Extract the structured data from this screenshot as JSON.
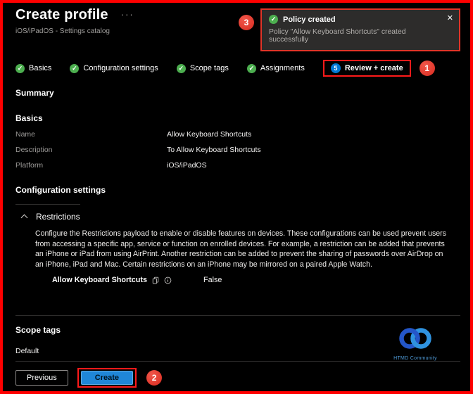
{
  "colors": {
    "accent_blue": "#0078d4",
    "success_green": "#4cae4f",
    "annotation_red": "#e23527",
    "highlight_red": "#fe0000",
    "logo_blue": "#2f7bdc"
  },
  "header": {
    "title": "Create profile",
    "menu_ellipsis": "···",
    "subtitle": "iOS/iPadOS - Settings catalog"
  },
  "toast": {
    "title": "Policy created",
    "message": "Policy \"Allow Keyboard Shortcuts\" created successfully",
    "close": "✕"
  },
  "icons": {
    "check": "✓"
  },
  "annotations": {
    "step1": "1",
    "step2": "2",
    "step3": "3"
  },
  "wizard": {
    "steps": [
      {
        "label": "Basics"
      },
      {
        "label": "Configuration settings"
      },
      {
        "label": "Scope tags"
      },
      {
        "label": "Assignments"
      },
      {
        "label": "Review + create",
        "number": "5"
      }
    ]
  },
  "summary": {
    "heading": "Summary"
  },
  "basics": {
    "heading": "Basics",
    "rows": [
      {
        "label": "Name",
        "value": "Allow Keyboard Shortcuts"
      },
      {
        "label": "Description",
        "value": "To Allow Keyboard Shortcuts"
      },
      {
        "label": "Platform",
        "value": "iOS/iPadOS"
      }
    ]
  },
  "configuration": {
    "heading": "Configuration settings",
    "group_label": "Restrictions",
    "description": "Configure the Restrictions payload to enable or disable features on devices. These configurations can be used prevent users from accessing a specific app, service or function on enrolled devices. For example, a restriction can be added that prevents an iPhone or iPad from using AirPrint. Another restriction can be added to prevent the sharing of passwords over AirDrop on an iPhone, iPad and Mac. Certain restrictions on an iPhone may be mirrored on a paired Apple Watch.",
    "setting_label": "Allow Keyboard Shortcuts",
    "setting_value": "False"
  },
  "scope_tags": {
    "heading": "Scope tags",
    "value": "Default"
  },
  "logo": {
    "label": "HTMD Community"
  },
  "footer": {
    "previous_label": "Previous",
    "create_label": "Create"
  }
}
